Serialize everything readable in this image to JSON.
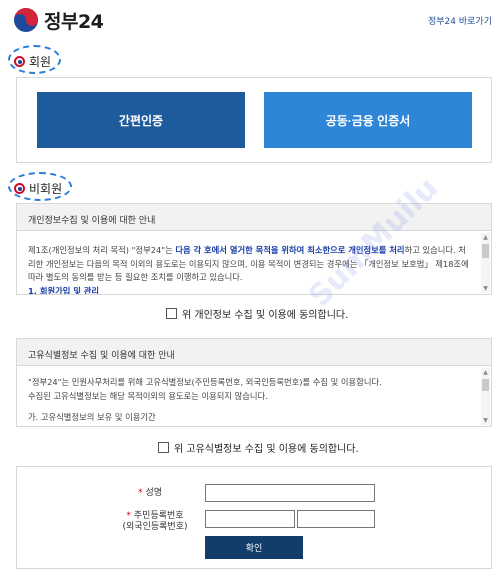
{
  "header": {
    "logo_text": "정부24",
    "shortcut_link": "정부24 바로가기"
  },
  "member": {
    "label": "회원",
    "simple_auth_button": "간편인증",
    "joint_cert_button": "공동·금융 인증서"
  },
  "non_member": {
    "label": "비회원"
  },
  "privacy_notice": {
    "title": "개인정보수집 및 이용에 대한 안내",
    "body_prefix": "제1조(개인정보의 처리 목적) \"정부24\"는 ",
    "body_highlight_1": "다음 각 호에서 열거한 목적을 위하여 최소한으로 개인정보를 처리",
    "body_mid_1": "하고 있습니다. 처리한 개인정보는 다음의 목적 이외의 용도로는 이용되지 않으며, 이용 목적이 변경되는 경우에는 「개인정보 보호법」 제18조에 따라 별도의 동의를 받는 등 필요한 조치를 이행하고 있습니다.",
    "body_item_1": "1. 회원가입 및 관리",
    "agree_label": "위 개인정보 수집 및 이용에 동의합니다."
  },
  "uid_notice": {
    "title": "고유식별정보 수집 및 이용에 대한 안내",
    "body_line_1": "\"정부24\"는 민원사무처리를 위해 고유식별정보(주민등록번호, 외국인등록번호)를 수집 및 이용합니다.",
    "body_line_2": "수집된 고유식별정보는 해당 목적이외의 용도로는 이용되지 않습니다.",
    "body_line_3": "가. 고유식별정보의 보유 및 이용기간",
    "agree_label": "위 고유식별정보 수집 및 이용에 동의합니다."
  },
  "form": {
    "name_label": "성명",
    "rrn_label_line1": "주민등록번호",
    "rrn_label_line2": "(외국인등록번호)",
    "rrn_separator": "-",
    "confirm_button": "확인",
    "required_mark": "*",
    "name_value": "",
    "rrn_front_value": "",
    "rrn_back_value": ""
  },
  "watermark": "SumMuilu",
  "colors": {
    "simple_auth_bg": "#1d5b9c",
    "joint_cert_bg": "#2f86d7",
    "confirm_bg": "#123d6b",
    "highlight_text": "#1a3ea8",
    "annotation_ring": "#2a7fd6"
  }
}
